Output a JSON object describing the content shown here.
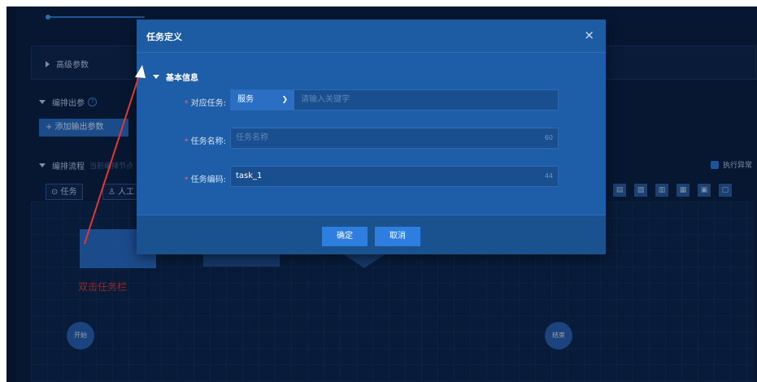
{
  "sections": {
    "advanced_params": "高级参数",
    "output_params": "编排出参",
    "add_output_param": "+ 添加输出参数",
    "flow_title": "编排流程",
    "flow_hint": "当前编排节点"
  },
  "toolbar": {
    "task_button": "⊙ 任务",
    "manual_button": "♙ 人工",
    "async_label": "执行异常"
  },
  "canvas": {
    "double_click_label": "双击任务栏",
    "start_node": "开始",
    "end_node": "结束"
  },
  "modal": {
    "title": "任务定义",
    "close_glyph": "×",
    "basic_info": "基本信息",
    "fields": [
      {
        "label": "对应任务:",
        "select_value": "服务",
        "placeholder": "请输入关键字"
      },
      {
        "label": "任务名称:",
        "placeholder": "任务名称",
        "counter": "60"
      },
      {
        "label": "任务编码:",
        "value": "task_1",
        "counter": "44"
      }
    ],
    "confirm": "确定",
    "cancel": "取消"
  },
  "icons": {
    "help": "help-circle-icon",
    "close": "close-icon",
    "chevron": "chevron-down-icon"
  },
  "colors": {
    "app_bg": "#0b1f3e",
    "modal_bg": "#1e5ea8",
    "primary_button": "#2e7ee0",
    "required_star": "#f0663c",
    "annotation_red": "#e0392f"
  }
}
